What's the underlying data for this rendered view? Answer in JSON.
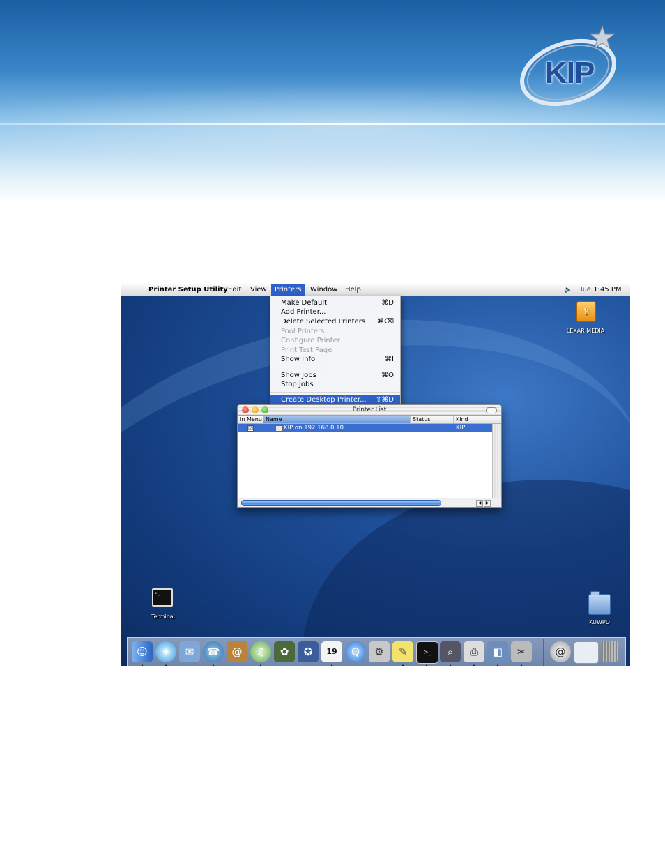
{
  "banner": {
    "logo_text": "KIP"
  },
  "menubar": {
    "app_name": "Printer Setup Utility",
    "menus": [
      "Edit",
      "View",
      "Printers",
      "Window",
      "Help"
    ],
    "volume_glyph": "🔈",
    "clock": "Tue 1:45 PM"
  },
  "printers_menu": {
    "items": [
      {
        "label": "Make Default",
        "shortcut": "⌘D",
        "enabled": true
      },
      {
        "label": "Add Printer...",
        "shortcut": "",
        "enabled": true
      },
      {
        "label": "Delete Selected Printers",
        "shortcut": "⌘⌫",
        "enabled": true
      },
      {
        "label": "Pool Printers...",
        "shortcut": "",
        "enabled": false
      },
      {
        "label": "Configure Printer",
        "shortcut": "",
        "enabled": false
      },
      {
        "label": "Print Test Page",
        "shortcut": "",
        "enabled": false
      },
      {
        "label": "Show Info",
        "shortcut": "⌘I",
        "enabled": true
      },
      {
        "label": "Show Jobs",
        "shortcut": "⌘O",
        "enabled": true
      },
      {
        "label": "Stop Jobs",
        "shortcut": "",
        "enabled": true
      },
      {
        "label": "Create Desktop Printer...",
        "shortcut": "⇧⌘D",
        "enabled": true,
        "highlighted": true
      }
    ]
  },
  "printer_list": {
    "title": "Printer List",
    "columns": [
      "In Menu",
      "Name",
      "Status",
      "Kind"
    ],
    "rows": [
      {
        "in_menu": "☑",
        "name": "KIP on 192.168.0.10",
        "status": "",
        "kind": "KIP"
      }
    ]
  },
  "desktop_icons": {
    "lexar": "LEXAR MEDIA",
    "terminal": "Terminal",
    "kuwpd": "KUWPD"
  },
  "dock_items": [
    "finder-icon",
    "safari-icon",
    "mail-icon",
    "ichat-icon",
    "address-book-icon",
    "itunes-icon",
    "iphoto-icon",
    "imovie-icon",
    "ical-icon",
    "quicktime-icon",
    "system-prefs-icon",
    "stickies-icon",
    "terminal-icon",
    "sherlock-icon",
    "printer-icon",
    "preview-icon",
    "grab-icon",
    "internet-connect-icon",
    "desktop-window-icon",
    "trash-icon"
  ],
  "calendar_day": "19"
}
